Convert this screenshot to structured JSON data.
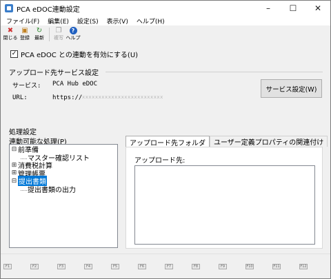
{
  "window": {
    "title": "PCA eDOC連動設定"
  },
  "window_controls": {
    "minimize": "–",
    "maximize": "☐",
    "close": "✕"
  },
  "menu": [
    "ファイル(F)",
    "編集(E)",
    "設定(S)",
    "表示(V)",
    "ヘルプ(H)"
  ],
  "toolbar": [
    {
      "label": "閉じる",
      "icon": "close-icon",
      "glyph": "✖",
      "color": "#d03030",
      "enabled": true
    },
    {
      "label": "登録",
      "icon": "register-icon",
      "glyph": "▣",
      "color": "#c08020",
      "enabled": true
    },
    {
      "label": "最新",
      "icon": "refresh-icon",
      "glyph": "↻",
      "color": "#2f8a2f",
      "enabled": true
    },
    {
      "label": "複写",
      "icon": "copy-icon",
      "glyph": "❐",
      "color": "#9a9a9a",
      "enabled": false
    },
    {
      "label": "ヘルプ",
      "icon": "help-icon",
      "glyph": "?",
      "color": "#2060c0",
      "enabled": true
    }
  ],
  "enable_checkbox": {
    "label": "PCA eDOC との連動を有効にする(U)",
    "checked": true,
    "mark": "✓"
  },
  "upload_service": {
    "title": "アップロード先サービス設定",
    "service_label": "サービス:",
    "service_value": "PCA Hub eDOC",
    "url_label": "URL:",
    "url_prefix": "https://",
    "url_rest": "xxxxxxxxxxxxxxxxxxxxxxxxx",
    "button": "サービス設定(W)"
  },
  "processing": {
    "title": "処理設定",
    "list_label": "連動可能な処理(P)",
    "tree": [
      {
        "label": "前準備",
        "expander": "⊟",
        "expanded": true,
        "children": [
          "マスター確認リスト"
        ]
      },
      {
        "label": "消費税計算",
        "expander": "⊞",
        "expanded": false,
        "children": []
      },
      {
        "label": "管理帳票",
        "expander": "⊞",
        "expanded": false,
        "children": []
      },
      {
        "label": "提出書類",
        "expander": "⊟",
        "expanded": true,
        "selected": true,
        "children": [
          "提出書類の出力"
        ]
      }
    ]
  },
  "tabs": [
    {
      "label": "アップロード先フォルダ",
      "active": true
    },
    {
      "label": "ユーザー定義プロパティの関連付け",
      "active": false
    }
  ],
  "upload_folder": {
    "label": "アップロード先:",
    "value": ""
  },
  "fkeys": [
    "F1",
    "F2",
    "F3",
    "F4",
    "F5",
    "F6",
    "F7",
    "F8",
    "F9",
    "F10",
    "F11",
    "F12"
  ]
}
